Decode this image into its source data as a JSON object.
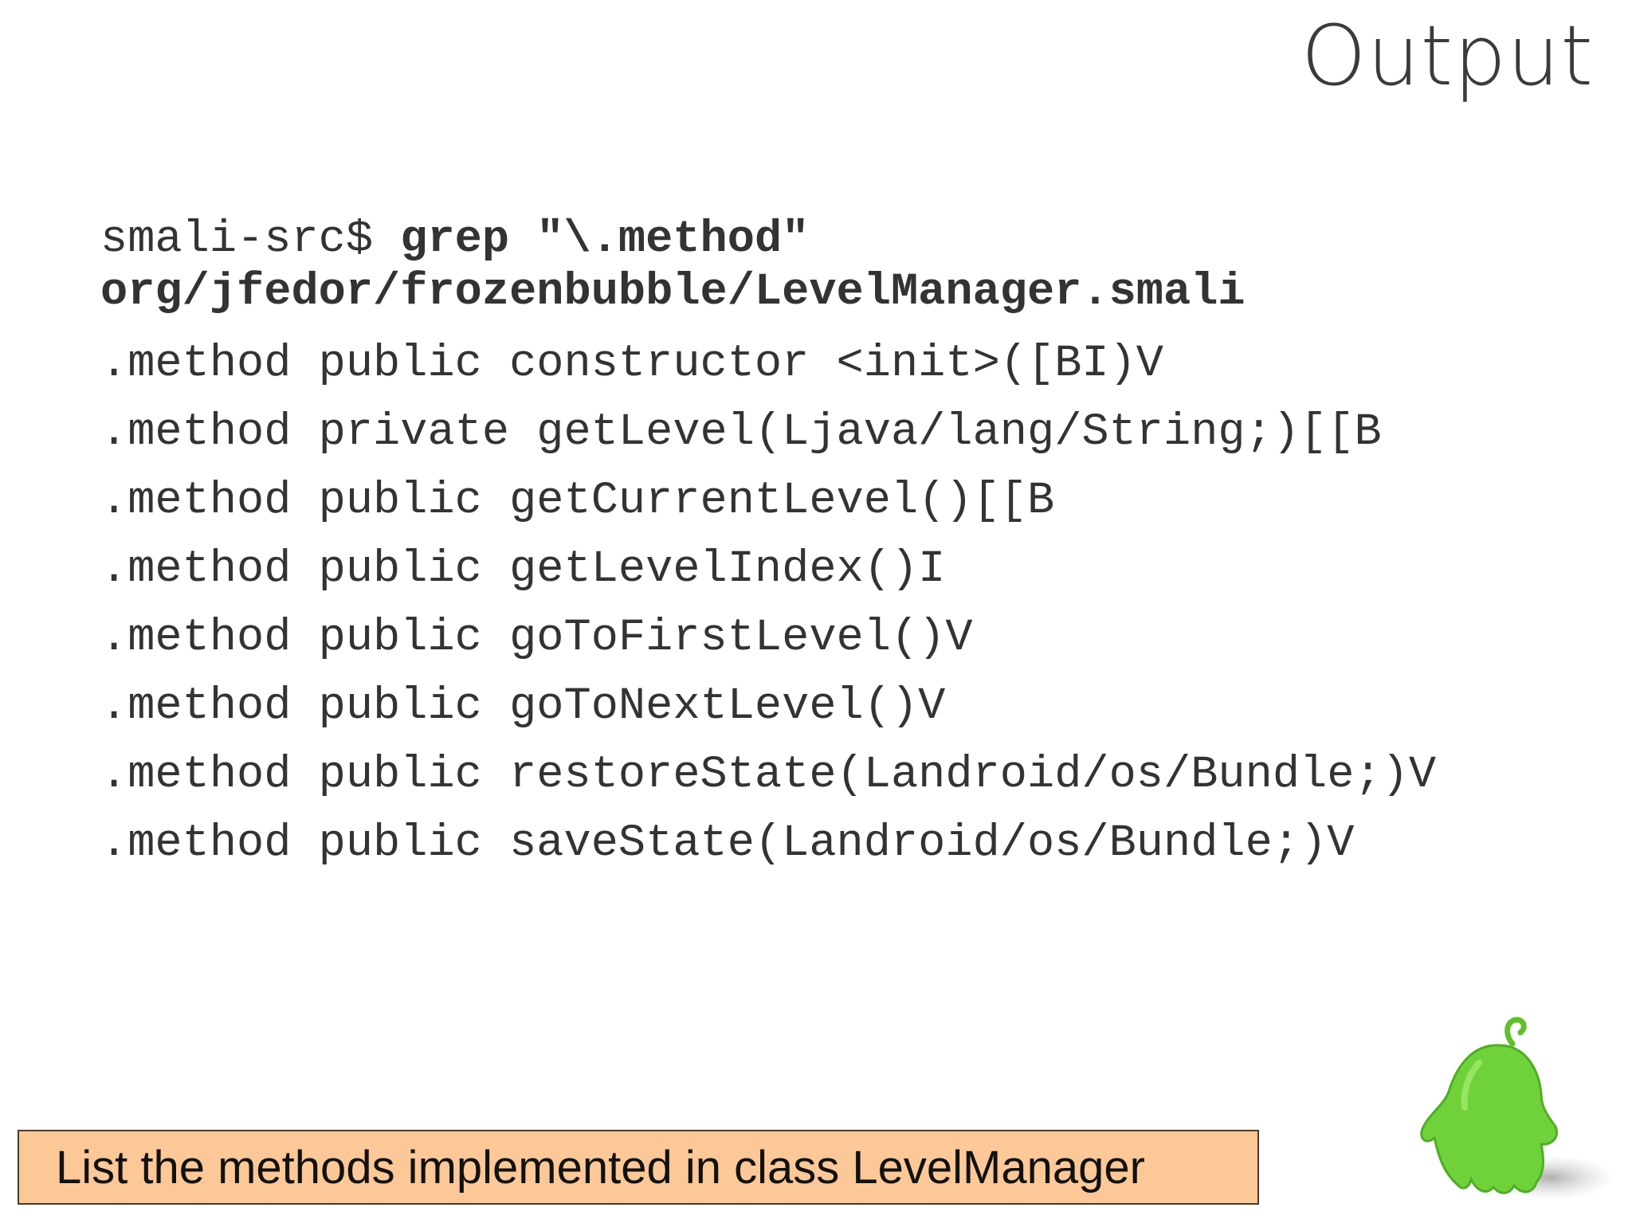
{
  "slide": {
    "title": "Output",
    "command": {
      "prompt": "smali-src$ ",
      "command_text": "grep \"\\.method\"",
      "path": "org/jfedor/frozenbubble/LevelManager.smali"
    },
    "output_lines": [
      ".method public constructor <init>([BI)V",
      ".method private getLevel(Ljava/lang/String;)[[B",
      ".method public getCurrentLevel()[[B",
      ".method public getLevelIndex()I",
      ".method public goToFirstLevel()V",
      ".method public goToNextLevel()V",
      ".method public restoreState(Landroid/os/Bundle;)V",
      ".method public saveState(Landroid/os/Bundle;)V"
    ],
    "caption": "List the methods implemented in class LevelManager"
  },
  "colors": {
    "caption_bg": "#fcc897",
    "mascot_green": "#6fd23a"
  },
  "icons": {
    "mascot": "green-blob-mascot-icon"
  }
}
